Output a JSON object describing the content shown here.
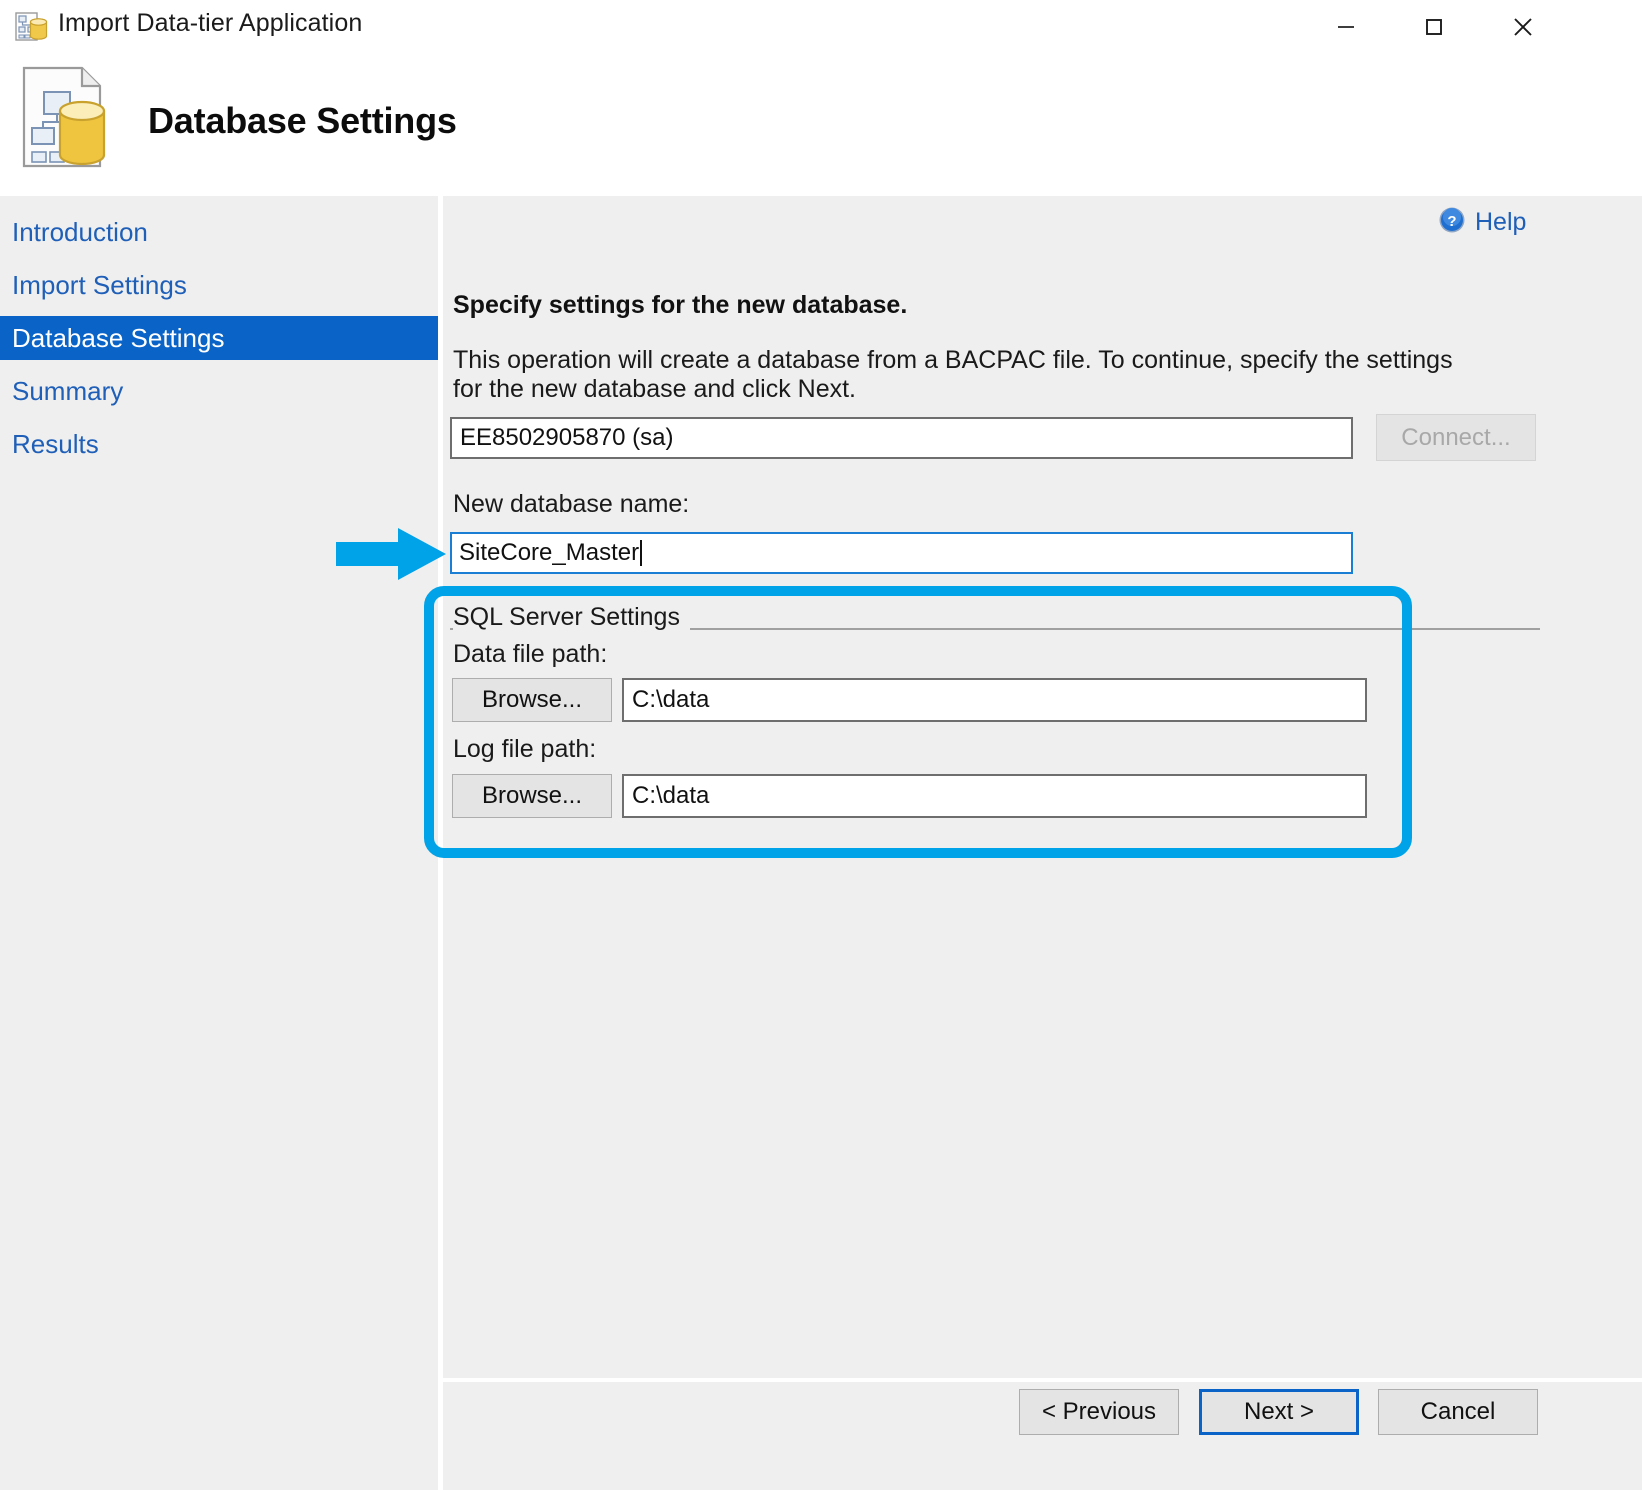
{
  "window": {
    "title": "Import Data-tier Application",
    "icon": "data-tier-app-icon",
    "controls": {
      "minimize": "minimize-icon",
      "maximize": "maximize-icon",
      "close": "close-icon"
    }
  },
  "header": {
    "title": "Database Settings",
    "icon": "database-settings-icon"
  },
  "sidebar": {
    "items": [
      {
        "label": "Introduction",
        "selected": false
      },
      {
        "label": "Import Settings",
        "selected": false
      },
      {
        "label": "Database Settings",
        "selected": true
      },
      {
        "label": "Summary",
        "selected": false
      },
      {
        "label": "Results",
        "selected": false
      }
    ]
  },
  "help": {
    "label": "Help",
    "icon": "help-circle-icon"
  },
  "main": {
    "lead": "Specify settings for the new database.",
    "description": "This operation will create a database from a BACPAC file. To continue, specify the settings for the new database and click Next.",
    "server_value": "EE8502905870 (sa)",
    "connect_label": "Connect...",
    "db_name_label": "New database name:",
    "db_name_value": "SiteCore_Master",
    "group": {
      "legend": "SQL Server Settings",
      "data_path_label": "Data file path:",
      "data_browse_label": "Browse...",
      "data_path_value": "C:\\data",
      "log_path_label": "Log file path:",
      "log_browse_label": "Browse...",
      "log_path_value": "C:\\data"
    }
  },
  "footer": {
    "previous_label": "< Previous",
    "next_label": "Next >",
    "cancel_label": "Cancel"
  },
  "annotations": {
    "highlight_color": "#00a2e8",
    "arrow": "right-arrow-annotation",
    "rect": "highlight-rectangle-annotation"
  }
}
